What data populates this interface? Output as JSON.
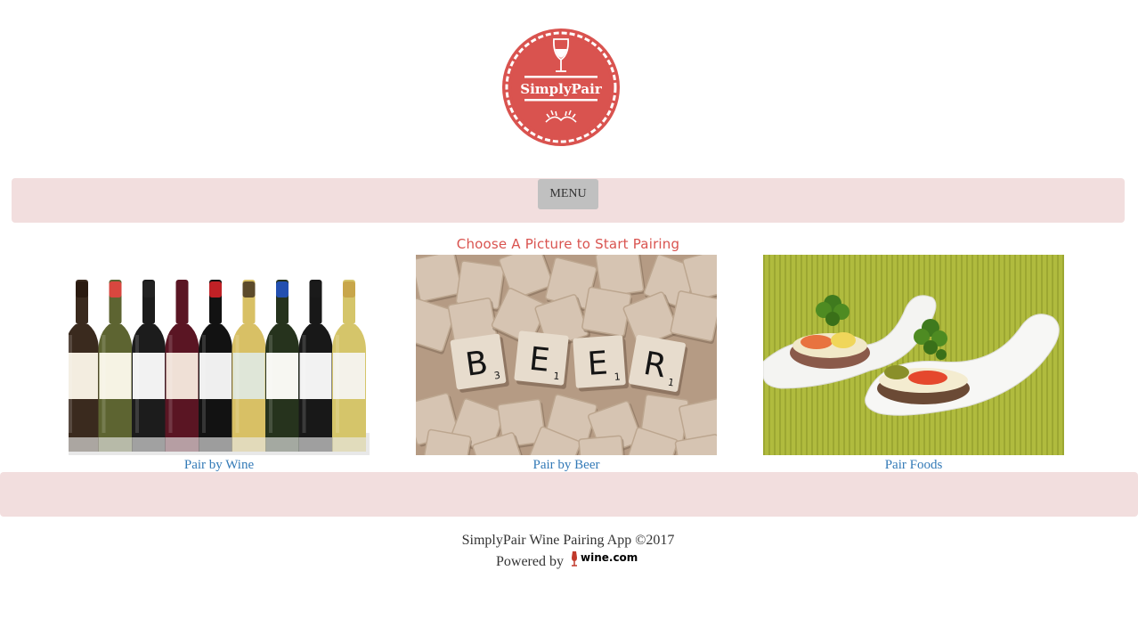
{
  "header": {
    "logo_text": "SimplyPair",
    "logo_colors": {
      "badge": "#d9534f",
      "ring": "#ffffff"
    }
  },
  "nav": {
    "menu_label": "MENU",
    "bar_color": "#f2dede"
  },
  "main": {
    "heading": "Choose A Picture to Start Pairing",
    "heading_color": "#d9534f",
    "cards": [
      {
        "label": "Pair by Wine",
        "image": "wine-bottles-image"
      },
      {
        "label": "Pair by Beer",
        "image": "beer-tiles-image"
      },
      {
        "label": "Pair Foods",
        "image": "food-spoons-image"
      }
    ],
    "beer_tiles": [
      {
        "letter": "B",
        "score": "3"
      },
      {
        "letter": "E",
        "score": "1"
      },
      {
        "letter": "E",
        "score": "1"
      },
      {
        "letter": "R",
        "score": "1"
      }
    ]
  },
  "footer": {
    "copyright": "SimplyPair Wine Pairing App ©2017",
    "powered_by": "Powered by",
    "partner_logo_text": "wine.com"
  }
}
